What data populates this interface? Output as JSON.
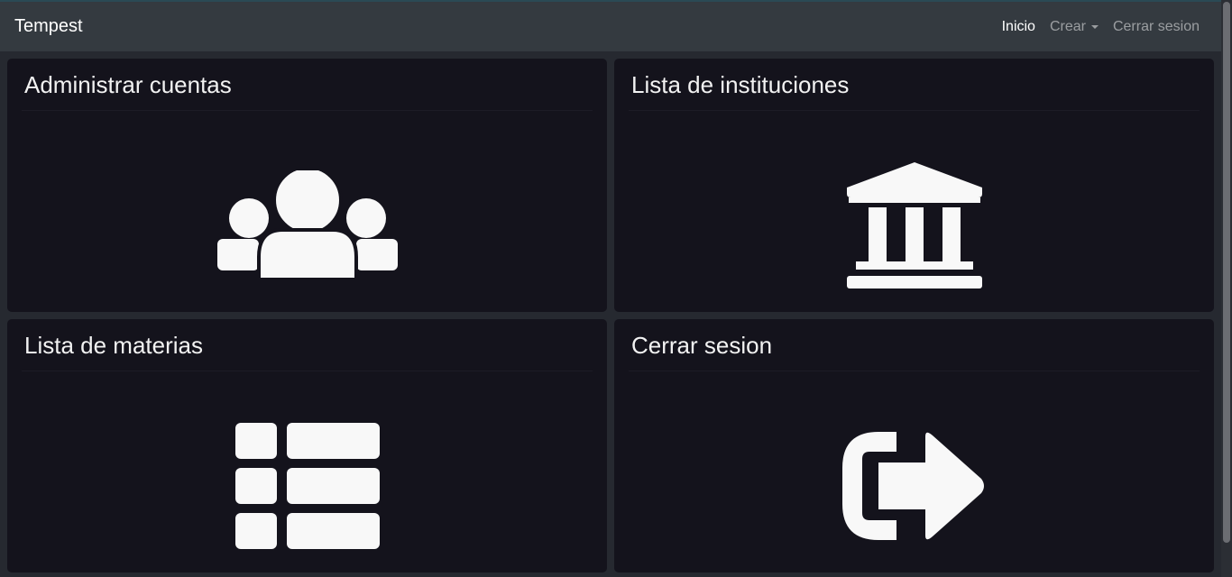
{
  "navbar": {
    "brand": "Tempest",
    "links": [
      {
        "label": "Inicio"
      },
      {
        "label": "Crear"
      },
      {
        "label": "Cerrar sesion"
      }
    ]
  },
  "cards": [
    {
      "title": "Administrar cuentas",
      "icon": "users-icon"
    },
    {
      "title": "Lista de instituciones",
      "icon": "university-icon"
    },
    {
      "title": "Lista de materias",
      "icon": "list-icon"
    },
    {
      "title": "Cerrar sesion",
      "icon": "sign-out-icon"
    }
  ],
  "colors": {
    "navbar_bg": "#343a40",
    "page_bg": "#262930",
    "card_bg": "#14131c",
    "icon_fill": "#f8f8f8"
  }
}
